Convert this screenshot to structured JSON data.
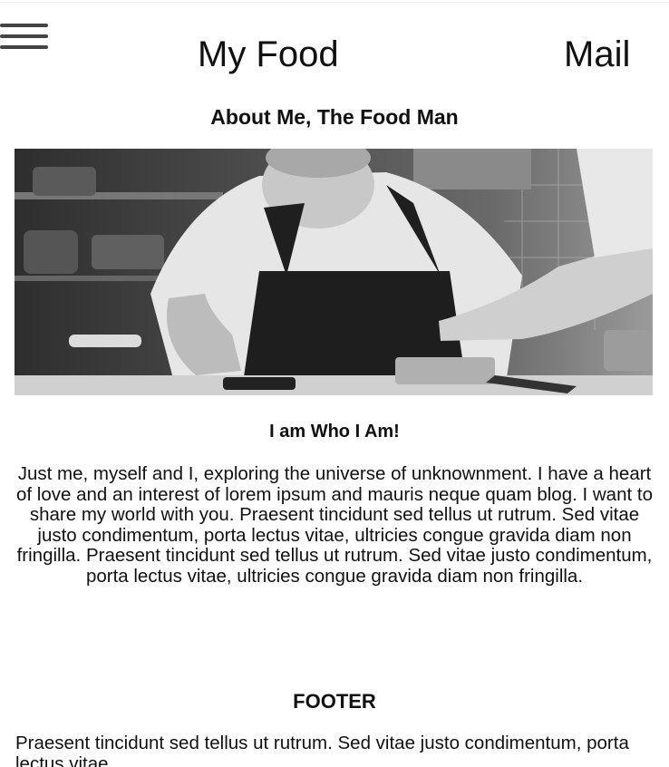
{
  "nav": {
    "menu_icon": "hamburger-menu-icon",
    "brand": "My Food",
    "mail": "Mail"
  },
  "about": {
    "title": "About Me, The Food Man",
    "image_subject": "black-and-white photo of a chef in an apron plating food in a kitchen",
    "subtitle": "I am Who I Am!",
    "body": "Just me, myself and I, exploring the universe of unknownment. I have a heart of love and an interest of lorem ipsum and mauris neque quam blog. I want to share my world with you. Praesent tincidunt sed tellus ut rutrum. Sed vitae justo condimentum, porta lectus vitae, ultricies congue gravida diam non fringilla. Praesent tincidunt sed tellus ut rutrum. Sed vitae justo condimentum, porta lectus vitae, ultricies congue gravida diam non fringilla."
  },
  "footer": {
    "title": "FOOTER",
    "text": "Praesent tincidunt sed tellus ut rutrum. Sed vitae justo condimentum, porta lectus vitae"
  }
}
